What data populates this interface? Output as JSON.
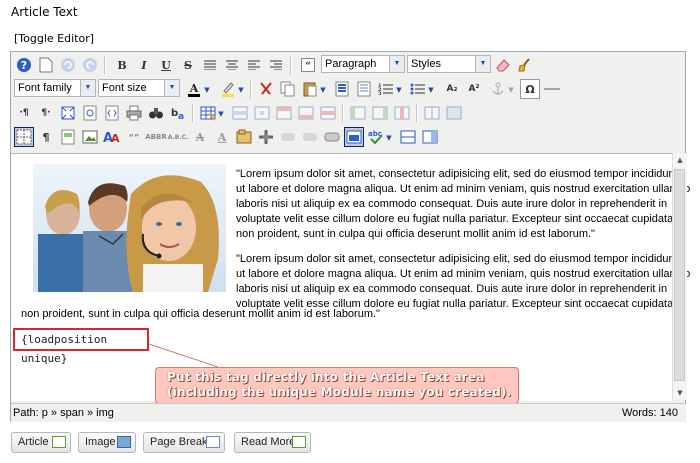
{
  "section_title": "Article Text",
  "toggle_editor": "[Toggle Editor]",
  "toolbar": {
    "bold": "B",
    "italic": "I",
    "underline": "U",
    "strike": "S",
    "format_select": "Paragraph",
    "styles_select": "Styles",
    "font_family_select": "Font family",
    "font_size_select": "Font size",
    "subscript": "A₂",
    "superscript": "A²",
    "omega": "Ω"
  },
  "content": {
    "para1": "\"Lorem ipsum dolor sit amet, consectetur adipisicing elit, sed do eiusmod tempor incididunt ut labore et dolore magna aliqua. Ut enim ad minim veniam, quis nostrud exercitation ullamco laboris nisi ut aliquip ex ea commodo consequat. Duis aute irure dolor in reprehenderit in voluptate velit esse cillum dolore eu fugiat nulla pariatur. Excepteur sint occaecat cupidatat non proident, sunt in culpa qui officia deserunt mollit anim id est laborum.\"",
    "para2_lines": [
      "\"Lorem ipsum dolor sit amet, consectetur adipisicing elit, sed do eiusmod tempor incididunt",
      "ut labore et dolore magna aliqua. Ut enim ad minim veniam, quis nostrud exercitation ullamco",
      "laboris nisi ut aliquip ex ea commodo consequat. Duis aute irure dolor in reprehenderit in",
      "voluptate velit esse cillum dolore eu fugiat nulla pariatur. Excepteur sint occaecat cupidatat",
      "non proident, sunt in culpa qui officia deserunt mollit anim id est laborum.\""
    ],
    "para1_lines": [
      "\"Lorem ipsum dolor sit amet, consectetur adipisicing elit, sed do eiusmod tempor incididunt",
      "ut labore et dolore magna aliqua. Ut enim ad minim veniam, quis nostrud exercitation ullamco",
      "laboris nisi ut aliquip ex ea commodo consequat. Duis aute irure dolor in reprehenderit in",
      "voluptate velit esse cillum dolore eu fugiat nulla pariatur. Excepteur sint occaecat cupidatat",
      "non proident, sunt in culpa qui officia deserunt mollit anim id est laborum.\""
    ],
    "loadposition_tag": "{loadposition unique}"
  },
  "callout": {
    "line1": "Put this tag directly into the Article Text area",
    "line2": "(including the unique Module name you created)."
  },
  "status": {
    "path": "Path:  p » span » img",
    "words": "Words: 140"
  },
  "bottom_buttons": [
    "Article",
    "Image",
    "Page Break",
    "Read More"
  ],
  "colors": {
    "callout_bg": "#ffc7bd",
    "tag_border": "#d42a2a",
    "toolbar_bg": "#f0f0ee"
  }
}
